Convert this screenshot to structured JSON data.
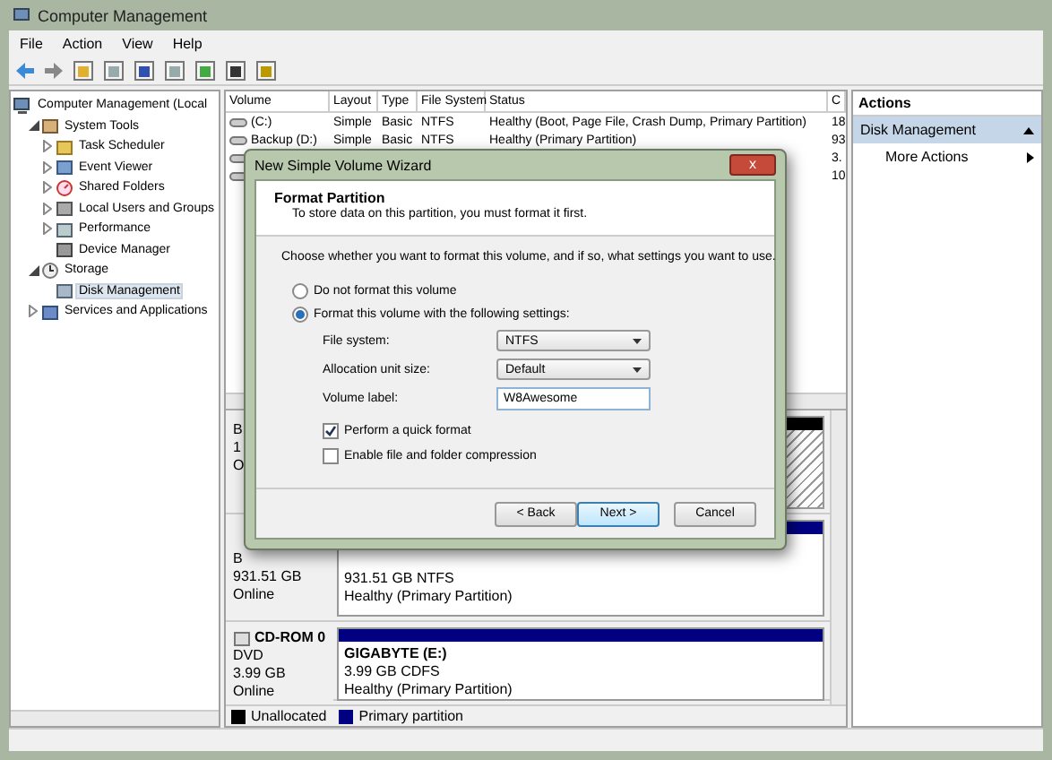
{
  "window": {
    "title": "Computer Management"
  },
  "menu": [
    "File",
    "Action",
    "View",
    "Help"
  ],
  "tree": [
    {
      "label": "Computer Management (Local",
      "selected": false,
      "children": [
        {
          "label": "System Tools",
          "kind": "node",
          "expanded": true,
          "selected": false,
          "children": [
            {
              "label": "Task Scheduler",
              "kind": "node",
              "expanded": false,
              "selected": false
            },
            {
              "label": "Event Viewer",
              "kind": "node",
              "expanded": false,
              "selected": false
            },
            {
              "label": "Shared Folders",
              "kind": "node",
              "expanded": false,
              "selected": false
            },
            {
              "label": "Local Users and Groups",
              "kind": "node",
              "expanded": false,
              "selected": false
            },
            {
              "label": "Performance",
              "kind": "node",
              "expanded": false,
              "selected": false
            },
            {
              "label": "Device Manager",
              "kind": "leaf",
              "selected": false
            }
          ]
        },
        {
          "label": "Storage",
          "kind": "node",
          "expanded": true,
          "selected": false,
          "children": [
            {
              "label": "Disk Management",
              "kind": "leaf",
              "selected": true
            }
          ]
        },
        {
          "label": "Services and Applications",
          "kind": "node",
          "expanded": false,
          "selected": false
        }
      ]
    }
  ],
  "table": {
    "columns": [
      "Volume",
      "Layout",
      "Type",
      "File System",
      "Status",
      "C"
    ],
    "rows": [
      {
        "volume": "(C:)",
        "layout": "Simple",
        "type": "Basic",
        "fs": "NTFS",
        "status": "Healthy (Boot, Page File, Crash Dump, Primary Partition)",
        "c": "18"
      },
      {
        "volume": "Backup (D:)",
        "layout": "Simple",
        "type": "Basic",
        "fs": "NTFS",
        "status": "Healthy (Primary Partition)",
        "c": "93"
      },
      {
        "c": "3."
      },
      {
        "c": "10"
      }
    ]
  },
  "disks": [
    {
      "labels": [
        "B",
        "1",
        "O"
      ],
      "partitions": [
        {
          "kind": "unallocated"
        }
      ]
    },
    {
      "labels": [
        "B",
        "931.51 GB",
        "Online"
      ],
      "partitions": [
        {
          "kind": "primary",
          "lines": [
            "931.51 GB NTFS",
            "Healthy (Primary Partition)"
          ]
        }
      ]
    },
    {
      "title": "CD-ROM 0",
      "labels": [
        "DVD",
        "3.99 GB",
        "Online"
      ],
      "partitions": [
        {
          "kind": "primary",
          "name": "GIGABYTE  (E:)",
          "lines": [
            "3.99 GB CDFS",
            "Healthy (Primary Partition)"
          ]
        }
      ]
    }
  ],
  "legend": [
    {
      "label": "Unallocated",
      "color": "#000000"
    },
    {
      "label": "Primary partition",
      "color": "#000080"
    }
  ],
  "actions": {
    "title": "Actions",
    "section": "Disk Management",
    "items": [
      "More Actions"
    ]
  },
  "dialog": {
    "title": "New Simple Volume Wizard",
    "close": "x",
    "heading": "Format Partition",
    "subheading": "To store data on this partition, you must format it first.",
    "instruction": "Choose whether you want to format this volume, and if so, what settings you want to use.",
    "options": [
      {
        "label": "Do not format this volume",
        "selected": false
      },
      {
        "label": "Format this volume with the following settings:",
        "selected": true
      }
    ],
    "fields": [
      {
        "label": "File system:",
        "kind": "select",
        "value": "NTFS"
      },
      {
        "label": "Allocation unit size:",
        "kind": "select",
        "value": "Default"
      },
      {
        "label": "Volume label:",
        "kind": "input",
        "value": "W8Awesome"
      }
    ],
    "checks": [
      {
        "label": "Perform a quick format",
        "checked": true
      },
      {
        "label": "Enable file and folder compression",
        "checked": false
      }
    ],
    "buttons": [
      {
        "label": "< Back",
        "default": false
      },
      {
        "label": "Next >",
        "default": true
      },
      {
        "label": "Cancel",
        "default": false
      }
    ]
  }
}
